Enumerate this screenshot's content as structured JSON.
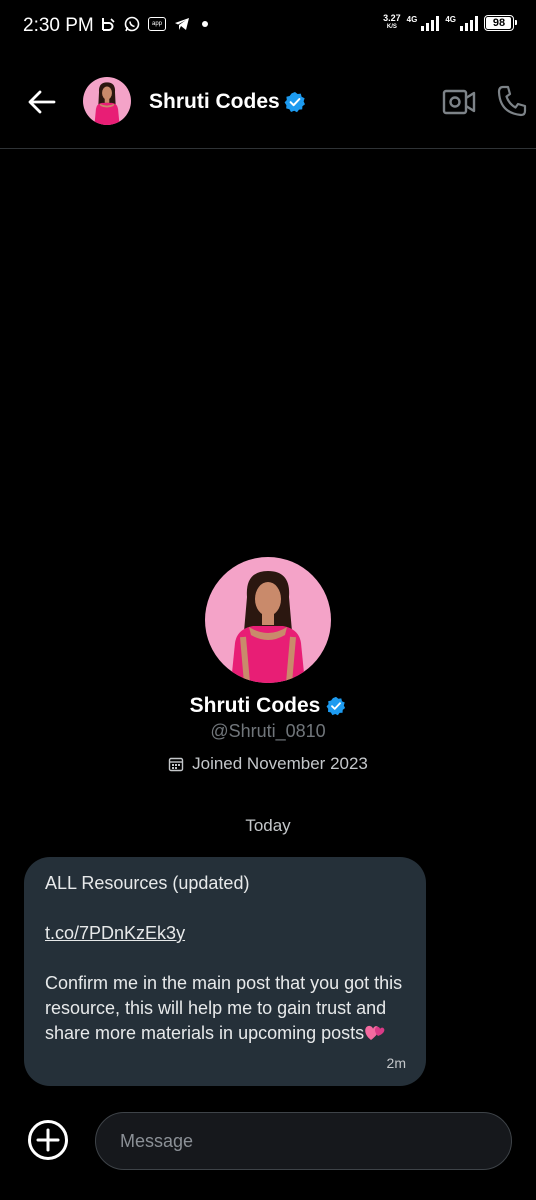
{
  "status_bar": {
    "time": "2:30 PM",
    "net_speed_value": "3.27",
    "net_speed_unit": "K/S",
    "signal1_label": "4G",
    "signal2_label": "4G",
    "battery_percent": "98",
    "battery_level": 0.98,
    "app_icon_text": "app",
    "icons": [
      "b-icon",
      "whatsapp-icon",
      "app-icon",
      "telegram-icon",
      "dot-icon"
    ]
  },
  "header": {
    "name": "Shruti Codes",
    "verified": true,
    "icons": [
      "back-arrow-icon",
      "video-call-icon",
      "phone-call-icon",
      "verified-badge-icon"
    ]
  },
  "profile": {
    "name": "Shruti Codes",
    "handle": "@Shruti_0810",
    "joined": "Joined November 2023",
    "icon": "calendar-icon"
  },
  "date_separator": "Today",
  "message": {
    "line1": "ALL Resources (updated)",
    "link": "t.co/7PDnKzEk3y",
    "body": "Confirm me in the main post that you got this resource, this will help me to gain trust and share more materials in upcoming posts",
    "emoji": "💞",
    "time": "2m"
  },
  "composer": {
    "placeholder": "Message",
    "add_icon": "add-circle-icon"
  },
  "colors": {
    "background": "#000000",
    "bubble": "#253039",
    "verified": "#1d9bf0",
    "avatar_bg": "#f4a3c8",
    "muted_text": "#71767b"
  }
}
